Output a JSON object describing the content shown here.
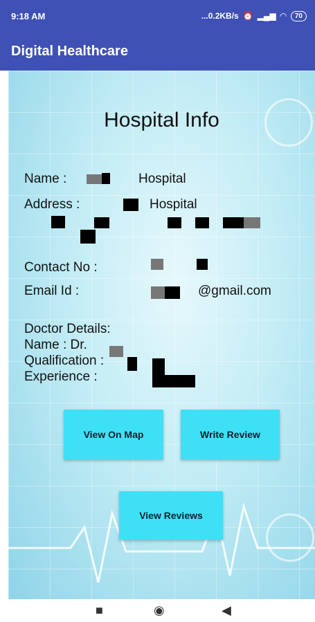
{
  "status_bar": {
    "time": "9:18 AM",
    "network_speed": "...0.2KB/s",
    "battery": "70"
  },
  "app_bar": {
    "title": "Digital Healthcare"
  },
  "page": {
    "title": "Hospital Info",
    "name_label": "Name  :",
    "name_value": "Hospital",
    "address_label": "Address :",
    "address_value": "Hospital",
    "contact_label": "Contact No  :",
    "email_label": "Email Id  :",
    "email_value": "@gmail.com",
    "doctor_details_label": "Doctor Details:",
    "doctor_name_label": "Name  : Dr.",
    "qualification_label": "Qualification :",
    "experience_label": "Experience :"
  },
  "buttons": {
    "view_on_map": "View On Map",
    "write_review": "Write Review",
    "view_reviews": "View Reviews"
  },
  "icons": [
    "alarm-icon",
    "wifi-icon",
    "signal-icon",
    "battery-icon",
    "recent-apps-icon",
    "home-icon",
    "back-icon"
  ]
}
